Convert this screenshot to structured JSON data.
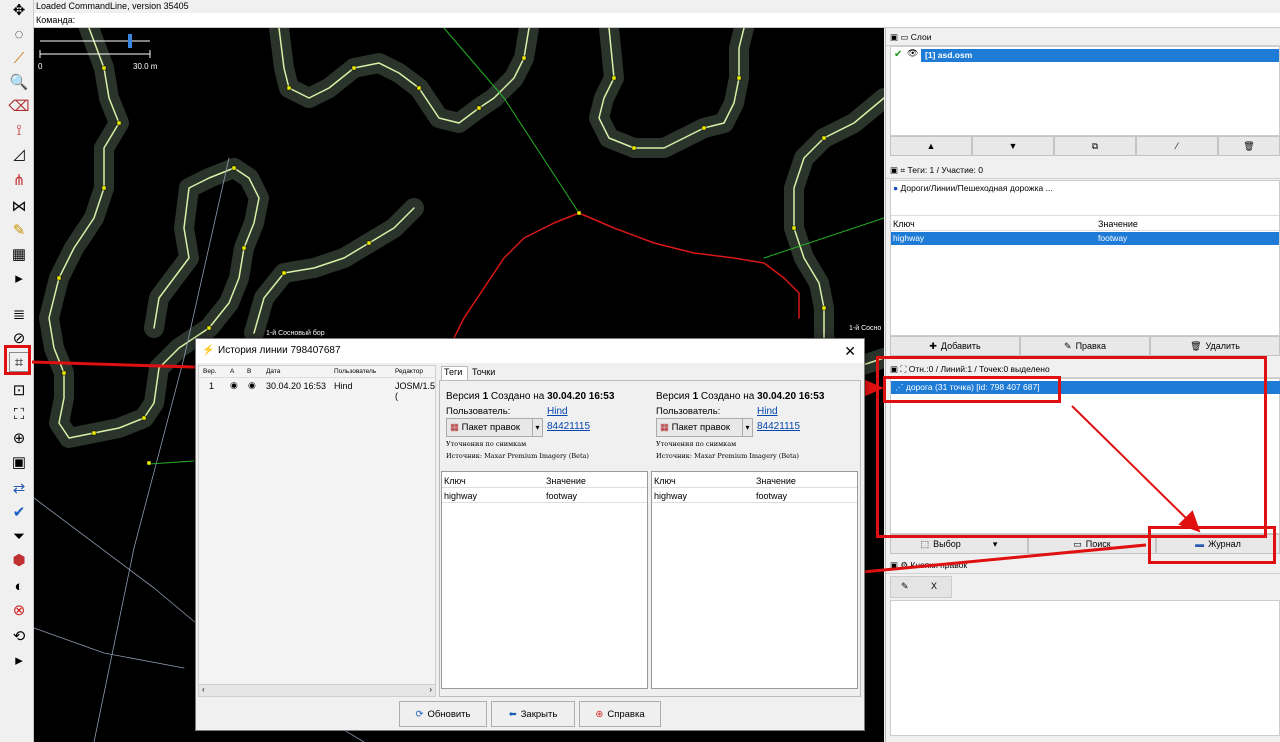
{
  "app": {
    "status_line": "Loaded CommandLine, version 35405",
    "command_label": "Команда:"
  },
  "map": {
    "scale_start": "0",
    "scale_end": "30.0 m",
    "place_label_1": "1-й Сосновый бор",
    "place_label_2": "1-й Сосно"
  },
  "layers_panel": {
    "title": "Слои",
    "layer_index": "[1]",
    "layer_name": "asd.osm"
  },
  "tags_panel": {
    "title": "Теги: 1 / Участие: 0",
    "preset": "Дороги/Линии/Пешеходная дорожка ...",
    "col_key": "Ключ",
    "col_value": "Значение",
    "row_key": "highway",
    "row_value": "footway",
    "add_label": "Добавить",
    "edit_label": "Правка",
    "delete_label": "Удалить"
  },
  "selection_panel": {
    "title": "Отн.:0 / Линий:1 / Точек:0 выделено",
    "item": "дорога (31 точка) [id: 798 407 687]",
    "select_label": "Выбор",
    "search_label": "Поиск",
    "history_label": "Журнал"
  },
  "bottom_panel": {
    "title": "Кнопки правок",
    "btn1": "✎",
    "btn2": "X"
  },
  "dialog": {
    "title": "История линии 798407687",
    "list_headers": [
      "Вер.",
      "A",
      "B",
      "Дата",
      "Пользователь",
      "Редактор"
    ],
    "row": {
      "ver": "1",
      "date": "30.04.20 16:53",
      "user": "Hind",
      "editor": "JOSM/1.5 ("
    },
    "tab_tags": "Теги",
    "tab_nodes": "Точки",
    "version_prefix": "Версия",
    "version_num": "1",
    "created_on": "Создано на",
    "created_date": "30.04.20 16:53",
    "user_label": "Пользователь:",
    "user_name": "Hind",
    "changeset_label": "Пакет правок",
    "changeset_id": "84421115",
    "comment_line": "Уточнения по снимкам",
    "source_line": "Источник: Maxar Premium Imagery (Beta)",
    "col_key": "Ключ",
    "col_value": "Значение",
    "tag_key": "highway",
    "tag_value": "footway",
    "btn_refresh": "Обновить",
    "btn_close": "Закрыть",
    "btn_help": "Справка"
  },
  "colors": {
    "map_bg": "#000000",
    "road_casing": "#2b342b",
    "road_line": "#d8f0a8",
    "selected_way": "#d81818",
    "annotation": "#e01010",
    "selection_blue": "#1e7bd6"
  }
}
